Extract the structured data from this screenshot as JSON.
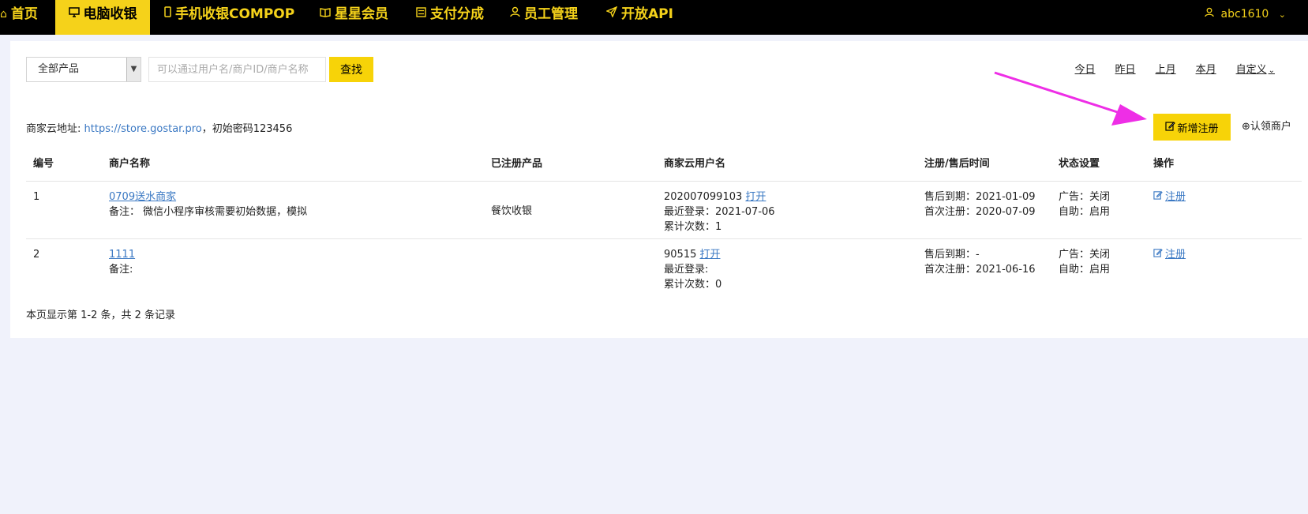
{
  "nav": {
    "items": [
      {
        "label": "首页",
        "icon": "home-icon"
      },
      {
        "label": "电脑收银",
        "icon": "monitor-icon",
        "active": true
      },
      {
        "label": "手机收银COMPOP",
        "icon": "mobile-icon"
      },
      {
        "label": "星星会员",
        "icon": "book-icon"
      },
      {
        "label": "支付分成",
        "icon": "list-icon"
      },
      {
        "label": "员工管理",
        "icon": "user-icon"
      },
      {
        "label": "开放API",
        "icon": "send-icon"
      }
    ],
    "user": "abc1610",
    "accent_color": "#f5d21a"
  },
  "filters": {
    "product_select": "全部产品",
    "search_placeholder": "可以通过用户名/商户ID/商户名称",
    "search_button": "查找",
    "dates": [
      "今日",
      "昨日",
      "上月",
      "本月",
      "自定义"
    ]
  },
  "cloud": {
    "prefix": "商家云地址: ",
    "url": "https://store.gostar.pro",
    "suffix": "，初始密码123456"
  },
  "actions": {
    "new_register": "新增注册",
    "claim_merchant": "认领商户"
  },
  "table": {
    "headers": [
      "编号",
      "商户名称",
      "已注册产品",
      "商家云用户名",
      "注册/售后时间",
      "状态设置",
      "操作"
    ],
    "rows": [
      {
        "no": "1",
        "name": "0709送水商家",
        "note": "备注：  微信小程序审核需要初始数据，模拟",
        "product": "餐饮收银",
        "username": "202007099103",
        "open_link": "打开",
        "last_login": "最近登录：2021-07-06",
        "count": "累计次数：1",
        "expire": "售后到期：2021-01-09",
        "first_reg": "首次注册：2020-07-09",
        "ad": "广告：关闭",
        "auto": "自助：启用",
        "op": "注册"
      },
      {
        "no": "2",
        "name": "1111",
        "note": "备注:",
        "product": "",
        "username": "90515",
        "open_link": "打开",
        "last_login": "最近登录:",
        "count": "累计次数：0",
        "expire": "售后到期：-",
        "first_reg": "首次注册：2021-06-16",
        "ad": "广告：关闭",
        "auto": "自助：启用",
        "op": "注册"
      }
    ]
  },
  "footer": "本页显示第 1-2 条，共 2 条记录",
  "annotation_color": "#ee2ee6"
}
